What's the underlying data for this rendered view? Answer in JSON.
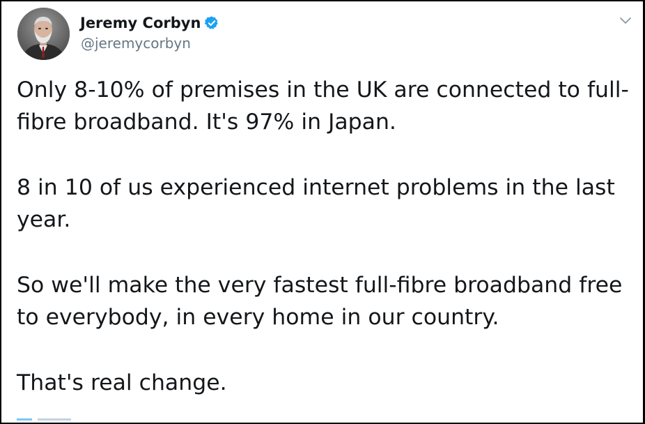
{
  "tweet": {
    "author": {
      "display_name": "Jeremy Corbyn",
      "handle": "@jeremycorbyn",
      "verified": true,
      "avatar_icon": "profile-photo"
    },
    "menu_icon": "chevron-down-icon",
    "paragraphs": [
      "Only 8-10% of premises in the UK are connected to full-fibre broadband. It's 97% in Japan.",
      "8 in 10 of us experienced internet problems in the last year.",
      "So we'll make the very fastest full-fibre broadband free to everybody, in every home in our country.",
      "That's real change."
    ]
  },
  "colors": {
    "text": "#14171a",
    "secondary_text": "#657786",
    "verified_blue": "#1da1f2",
    "border": "#000000"
  }
}
